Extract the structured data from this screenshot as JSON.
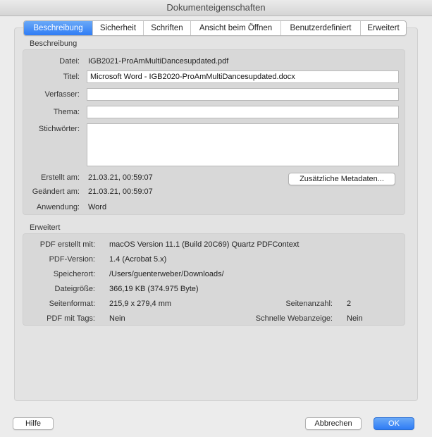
{
  "window": {
    "title": "Dokumenteigenschaften"
  },
  "tabs": [
    {
      "label": "Beschreibung",
      "active": true
    },
    {
      "label": "Sicherheit"
    },
    {
      "label": "Schriften"
    },
    {
      "label": "Ansicht beim Öffnen"
    },
    {
      "label": "Benutzerdefiniert"
    },
    {
      "label": "Erweitert"
    }
  ],
  "description": {
    "heading": "Beschreibung",
    "file_label": "Datei:",
    "file_value": "IGB2021-ProAmMultiDancesupdated.pdf",
    "title_label": "Titel:",
    "title_value": "Microsoft Word - IGB2020-ProAmMultiDancesupdated.docx",
    "author_label": "Verfasser:",
    "author_value": "",
    "subject_label": "Thema:",
    "subject_value": "",
    "keywords_label": "Stichwörter:",
    "keywords_value": "",
    "created_label": "Erstellt am:",
    "created_value": "21.03.21, 00:59:07",
    "modified_label": "Geändert am:",
    "modified_value": "21.03.21, 00:59:07",
    "application_label": "Anwendung:",
    "application_value": "Word",
    "metadata_button": "Zusätzliche Metadaten..."
  },
  "advanced": {
    "heading": "Erweitert",
    "producer_label": "PDF erstellt mit:",
    "producer_value": "macOS Version 11.1 (Build 20C69) Quartz PDFContext",
    "version_label": "PDF-Version:",
    "version_value": "1.4 (Acrobat 5.x)",
    "location_label": "Speicherort:",
    "location_value": "/Users/guenterweber/Downloads/",
    "filesize_label": "Dateigröße:",
    "filesize_value": "366,19 KB (374.975 Byte)",
    "pagesize_label": "Seitenformat:",
    "pagesize_value": "215,9 x 279,4 mm",
    "pagecount_label": "Seitenanzahl:",
    "pagecount_value": "2",
    "tagged_label": "PDF mit Tags:",
    "tagged_value": "Nein",
    "fastweb_label": "Schnelle Webanzeige:",
    "fastweb_value": "Nein"
  },
  "footer": {
    "help_button": "Hilfe",
    "cancel_button": "Abbrechen",
    "ok_button": "OK"
  },
  "colors": {
    "accent": "#2f7cf5",
    "panel": "#e3e3e3",
    "group": "#d8d8d8"
  }
}
